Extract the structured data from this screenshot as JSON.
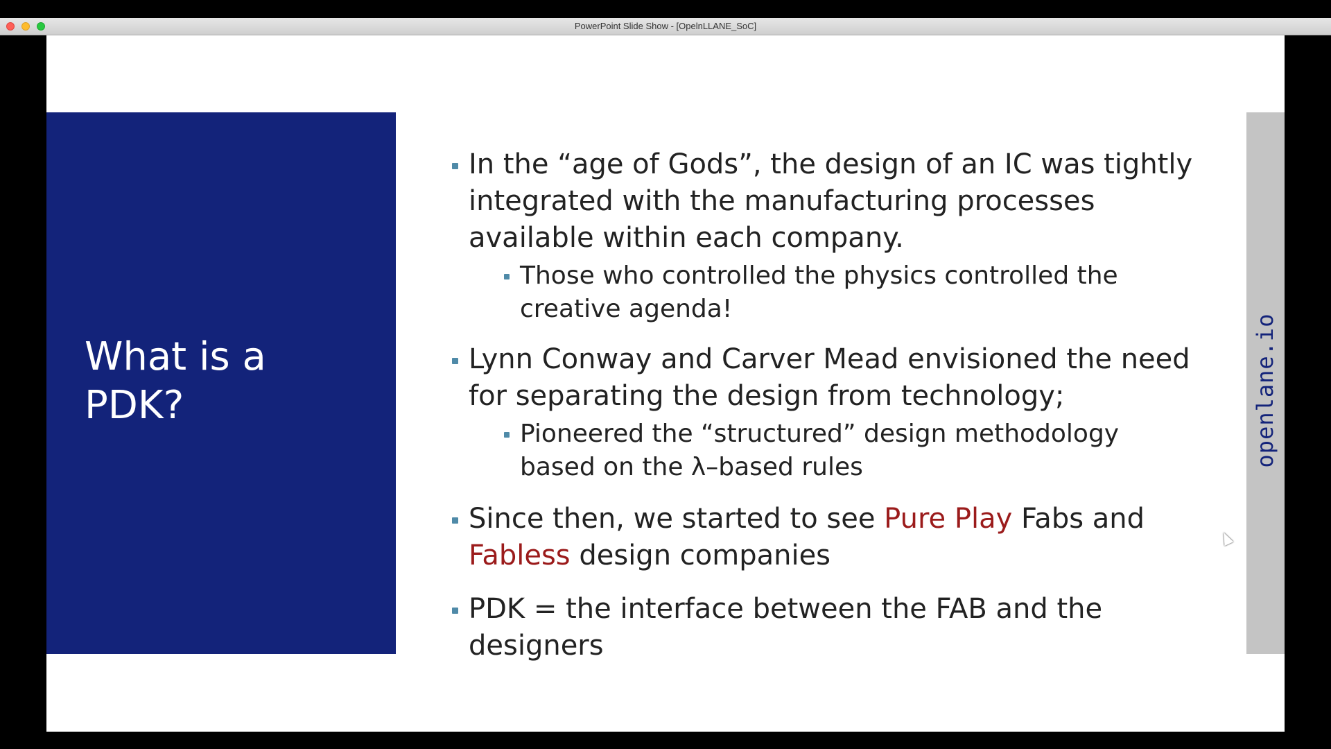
{
  "window": {
    "title": "PowerPoint Slide Show - [OpelnLLANE_SoC]"
  },
  "slide": {
    "title": "What is a\nPDK?",
    "bullets": {
      "b1": "In the “age of Gods”, the design of an IC was tightly integrated with the manufacturing processes available within each company.",
      "b1_sub": "Those who controlled the physics controlled the creative agenda!",
      "b2": "Lynn Conway and Carver Mead envisioned the need for separating the design from technology;",
      "b2_sub": "Pioneered the  “structured” design methodology based on the λ–based rules",
      "b3_part1": "Since then, we started to see ",
      "b3_hl1": "Pure Play",
      "b3_part2": " Fabs and ",
      "b3_hl2": "Fabless",
      "b3_part3": " design companies",
      "b4": "PDK = the interface between the FAB and the designers"
    },
    "brand": "openlane.io"
  },
  "colors": {
    "panel_blue": "#13237a",
    "highlight_red": "#9b1b1b",
    "bullet_teal": "#4f8aa8",
    "strip_gray": "#c4c4c4"
  }
}
